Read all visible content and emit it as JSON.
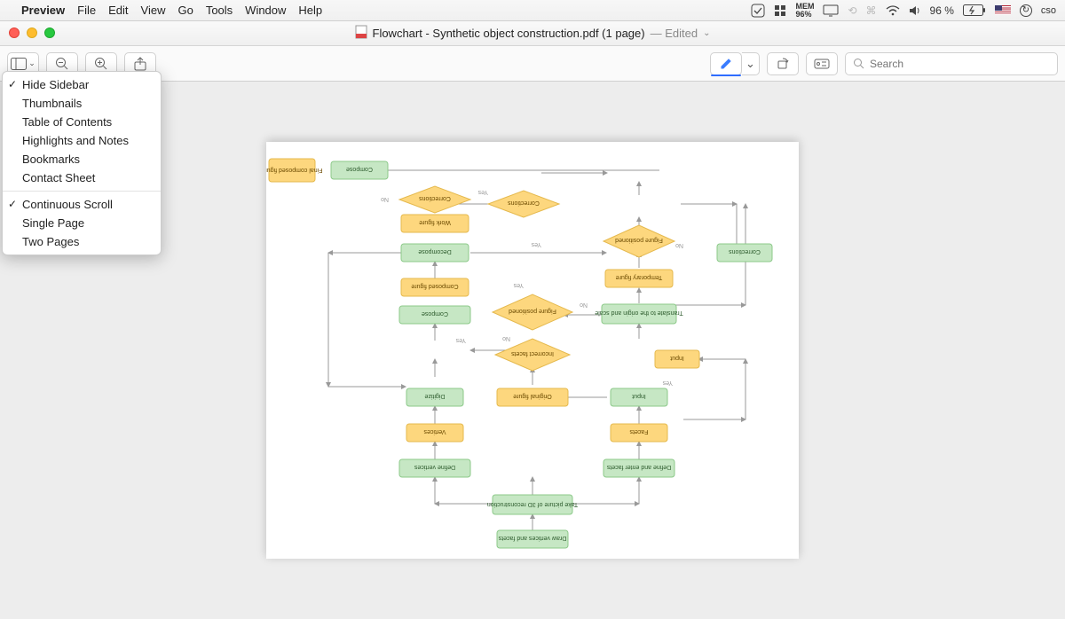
{
  "menubar": {
    "app": "Preview",
    "items": [
      "File",
      "Edit",
      "View",
      "Go",
      "Tools",
      "Window",
      "Help"
    ],
    "mem_label": "MEM",
    "mem_value": "96%",
    "battery": "96 %",
    "cso": "cso"
  },
  "window": {
    "icon": "pdf",
    "title": "Flowchart - Synthetic object construction.pdf (1 page)",
    "edited": "Edited"
  },
  "toolbar": {
    "search_placeholder": "Search"
  },
  "dropdown": {
    "items": [
      {
        "label": "Hide Sidebar",
        "checked": true
      },
      {
        "label": "Thumbnails",
        "checked": false
      },
      {
        "label": "Table of Contents",
        "checked": false
      },
      {
        "label": "Highlights and Notes",
        "checked": false
      },
      {
        "label": "Bookmarks",
        "checked": false
      },
      {
        "label": "Contact Sheet",
        "checked": false
      }
    ],
    "group2": [
      {
        "label": "Continuous Scroll",
        "checked": true
      },
      {
        "label": "Single Page",
        "checked": false
      },
      {
        "label": "Two Pages",
        "checked": false
      }
    ]
  },
  "flow": {
    "draw": "Draw vertices and facets",
    "take": "Take picture of 3D reconstruction",
    "define_enter": "Define and enter facets",
    "define_v": "Define vertices",
    "facets": "Facets",
    "vertices": "Vertices",
    "input": "Input",
    "input2": "Input",
    "digitize": "Digitize",
    "original": "Original figure",
    "incorrect": "Incorrect facets",
    "figure_positioned": "Figure positioned",
    "figure_positioned2": "Figure positioned",
    "translate": "Translate to the origin and scale",
    "temporary": "Temporary figure",
    "compose": "Compose",
    "compose2": "Compose",
    "composed": "Composed figure",
    "decompose": "Decompose",
    "work": "Work figure",
    "corrections": "Corrections",
    "corrections2": "Corrections",
    "corrections3": "Corrections",
    "final": "Final composed figure",
    "yes": "Yes",
    "no": "No"
  }
}
